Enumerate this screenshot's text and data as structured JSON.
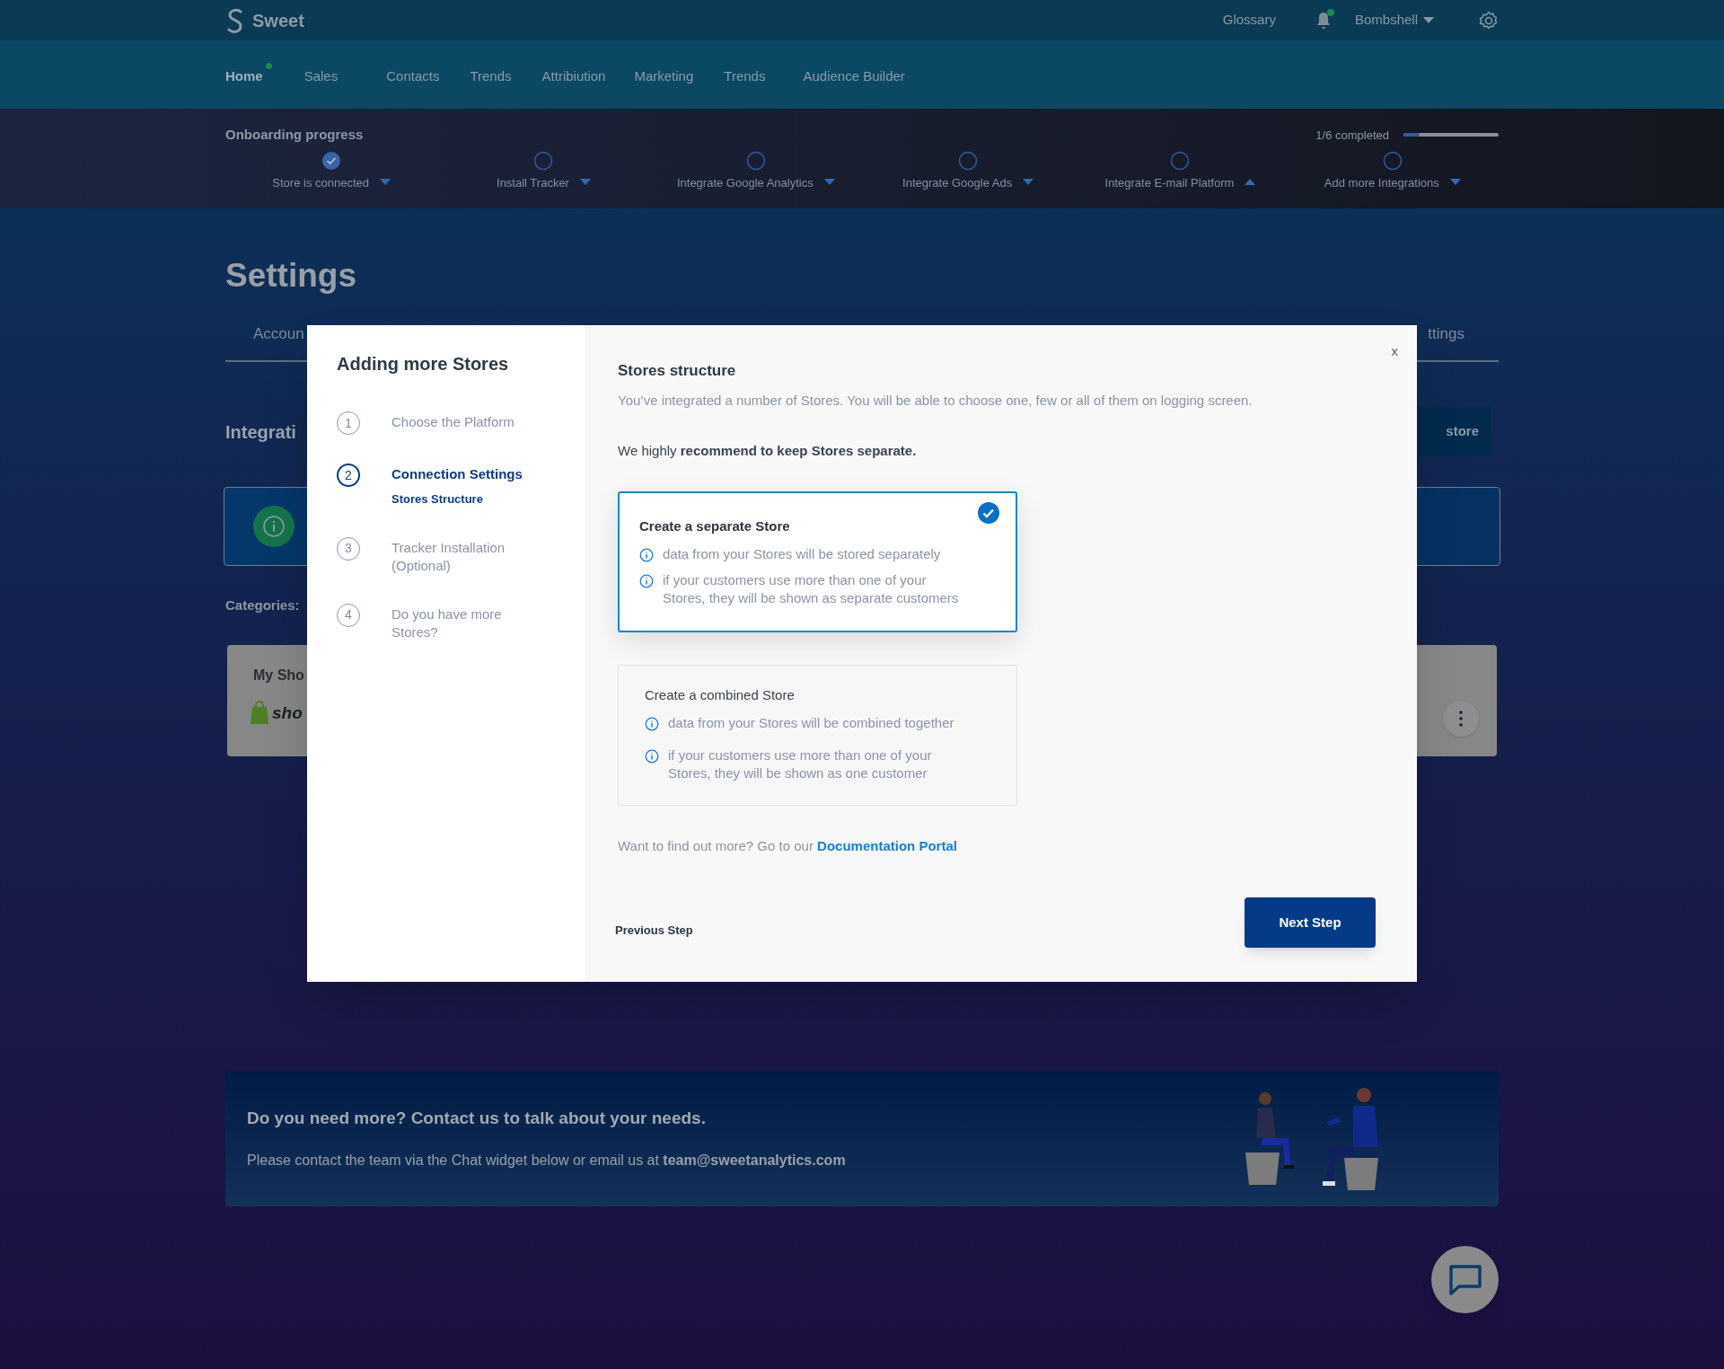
{
  "topbar": {
    "brand": "Sweet",
    "glossary": "Glossary",
    "unread": true,
    "user": "Bombshell"
  },
  "nav": [
    {
      "label": "Home",
      "selected": true
    },
    {
      "label": "Sales",
      "selected": false
    },
    {
      "label": "Contacts",
      "selected": false
    },
    {
      "label": "Trends",
      "selected": false
    },
    {
      "label": "Attribiution",
      "selected": false
    },
    {
      "label": "Marketing",
      "selected": false
    },
    {
      "label": "Trends",
      "selected": false
    },
    {
      "label": "Audience Builder",
      "selected": false
    }
  ],
  "onboarding": {
    "title": "Onboarding progress",
    "completed": "1/6 completed",
    "level": 0.17,
    "steps": [
      {
        "label": "Store is connected",
        "done": true,
        "expanded": false
      },
      {
        "label": "Install Tracker",
        "done": false,
        "expanded": false
      },
      {
        "label": "Integrate Google Analytics",
        "done": false,
        "expanded": false
      },
      {
        "label": "Integrate Google Ads",
        "done": false,
        "expanded": false
      },
      {
        "label": "Integrate E-mail Platform",
        "done": false,
        "expanded": true
      },
      {
        "label": "Add more Integrations",
        "done": false,
        "expanded": false
      }
    ]
  },
  "page": {
    "title": "Settings",
    "tabs": [
      "Accoun",
      "ttings"
    ],
    "section_title": "Integrati",
    "add_button": "store",
    "categories_label": "Categories:",
    "store_card": {
      "name": "My Sho",
      "logo_text": "sho"
    }
  },
  "modal": {
    "title": "Adding more Stores",
    "steps": [
      {
        "number": "1",
        "label": "Choose the Platform",
        "selected": false
      },
      {
        "number": "2",
        "label": "Connection Settings",
        "sublabel": "Stores Structure",
        "selected": true
      },
      {
        "number": "3",
        "label": "Tracker Installation (Optional)",
        "selected": false
      },
      {
        "number": "4",
        "label": "Do you have more Stores?",
        "selected": false
      }
    ],
    "close": "x",
    "heading": "Stores structure",
    "description": "You’ve integrated a number of Stores. You will be able to choose one, few or all of them on logging screen.",
    "recommendation": "We highly **recommend to keep Stores separate.**",
    "options": [
      {
        "title": "Create a separate Store",
        "selected": true,
        "points": [
          "data from your Stores will be stored separately",
          "if your customers use more than one of your Stores, they will be shown as separate customers"
        ]
      },
      {
        "title": "Create a combined Store",
        "selected": false,
        "points": [
          "data from your Stores will be combined together",
          "if your customers use more than one of your Stores, they will be shown as one customer"
        ]
      }
    ],
    "more_info": "Want to find out more? Go to our",
    "link": "Documentation Portal",
    "previous": "Previous Step",
    "next": "Next Step"
  },
  "contact": {
    "title": "Do you need more? Contact us to talk about your needs.",
    "text": "Please contact the team via the Chat widget below or email us at **team@sweetanalytics.com**"
  }
}
